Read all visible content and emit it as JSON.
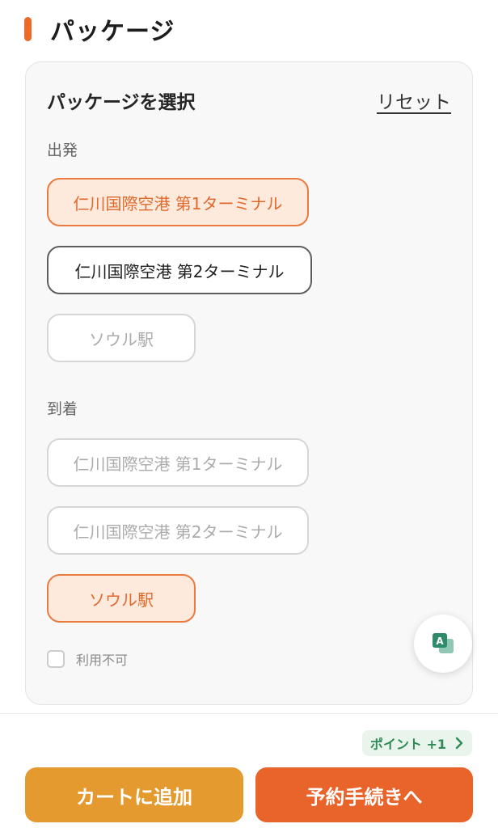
{
  "section": {
    "title": "パッケージ"
  },
  "card": {
    "title": "パッケージを選択",
    "reset": "リセット",
    "departure": {
      "label": "出発",
      "options": [
        {
          "label": "仁川国際空港 第1ターミナル",
          "state": "selected"
        },
        {
          "label": "仁川国際空港 第2ターミナル",
          "state": "available"
        },
        {
          "label": "ソウル駅",
          "state": "disabled"
        }
      ]
    },
    "arrival": {
      "label": "到着",
      "options": [
        {
          "label": "仁川国際空港 第1ターミナル",
          "state": "disabled"
        },
        {
          "label": "仁川国際空港 第2ターミナル",
          "state": "disabled"
        },
        {
          "label": "ソウル駅",
          "state": "selected"
        }
      ]
    },
    "unavailable_label": "利用不可"
  },
  "bottom": {
    "points": "ポイント +1",
    "cart_button": "カートに追加",
    "book_button": "予約手続きへ"
  },
  "colors": {
    "accent": "#ea6a2c",
    "cart": "#e49a2e",
    "book": "#e8642a",
    "points_bg": "#e8f4ec",
    "points_text": "#2f8a55"
  },
  "icons": {
    "translate": "translate-icon",
    "points_chevron": "chevron-right-icon"
  }
}
